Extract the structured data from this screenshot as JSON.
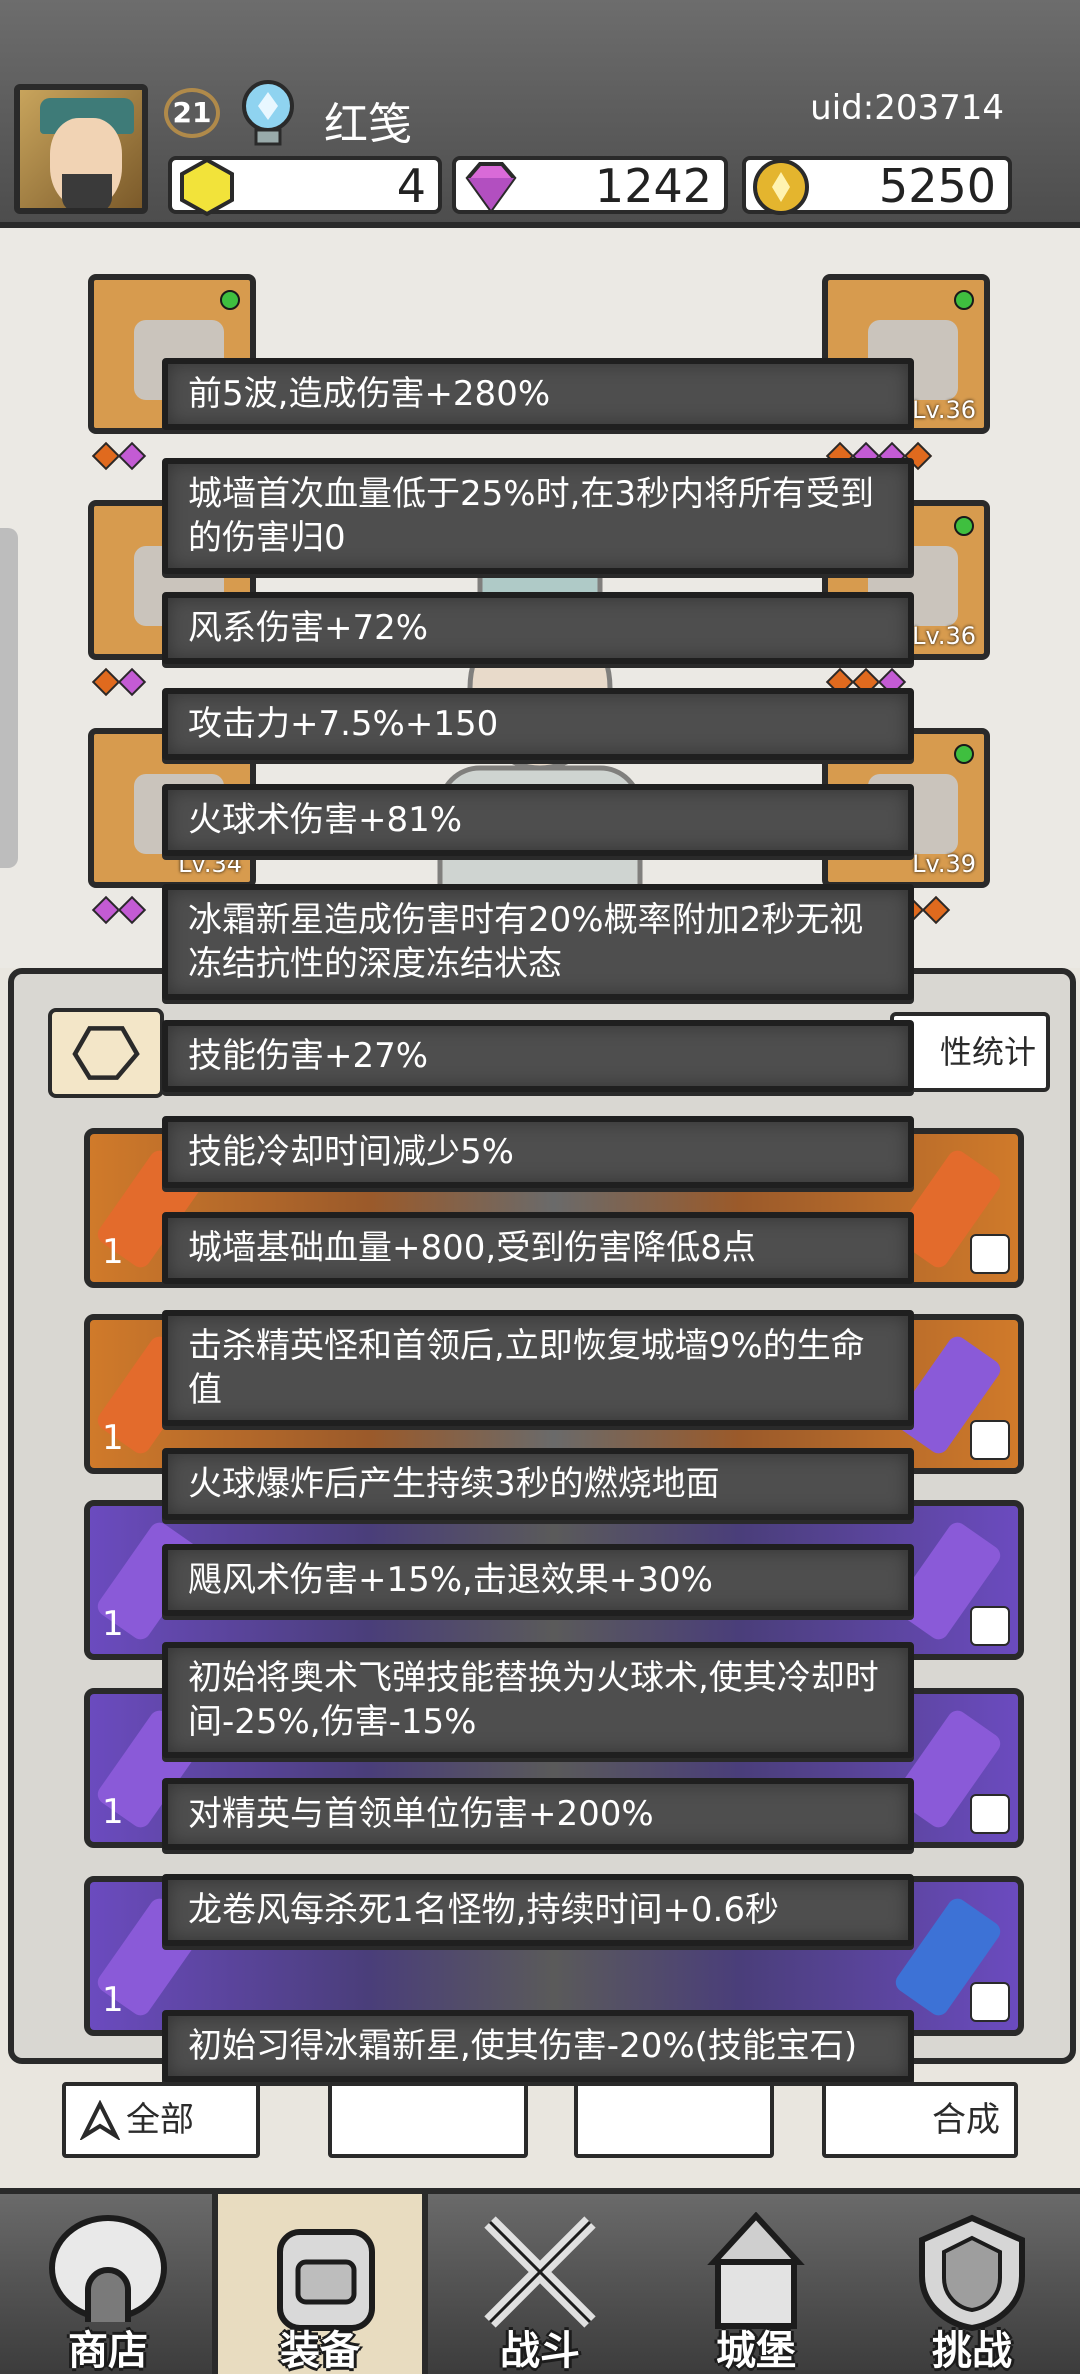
{
  "player": {
    "level": "21",
    "name": "红笺",
    "uid": "uid:203714"
  },
  "currency": {
    "gold_gem": "4",
    "diamond": "1242",
    "coin": "5250"
  },
  "slots": {
    "right_lv_1": "Lv.36",
    "right_lv_2": "Lv.36",
    "right_lv_3": "Lv.39",
    "left_lv_3": "Lv.34"
  },
  "bag": {
    "stats_label": "性统计",
    "row_counts": [
      "1",
      "1",
      "1",
      "1",
      "1"
    ],
    "btn_all": "全部",
    "btn_merge": "合成"
  },
  "tooltips": [
    "前5波,造成伤害+280%",
    "城墙首次血量低于25%时,在3秒内将所有受到的伤害归0",
    "风系伤害+72%",
    "攻击力+7.5%+150",
    "火球术伤害+81%",
    "冰霜新星造成伤害时有20%概率附加2秒无视冻结抗性的深度冻结状态",
    "技能伤害+27%",
    "技能冷却时间减少5%",
    "城墙基础血量+800,受到伤害降低8点",
    "击杀精英怪和首领后,立即恢复城墙9%的生命值",
    "火球爆炸后产生持续3秒的燃烧地面",
    "飓风术伤害+15%,击退效果+30%",
    "初始将奥术飞弹技能替换为火球术,使其冷却时间-25%,伤害-15%",
    "对精英与首领单位伤害+200%",
    "龙卷风每杀死1名怪物,持续时间+0.6秒",
    "初始习得冰霜新星,使其伤害-20%(技能宝石)"
  ],
  "nav": [
    "商店",
    "装备",
    "战斗",
    "城堡",
    "挑战"
  ],
  "colors": {
    "tooltip_bg": "#4e4e4e",
    "accent_orange": "#d79b4e",
    "accent_purple": "#6b4bbf"
  }
}
